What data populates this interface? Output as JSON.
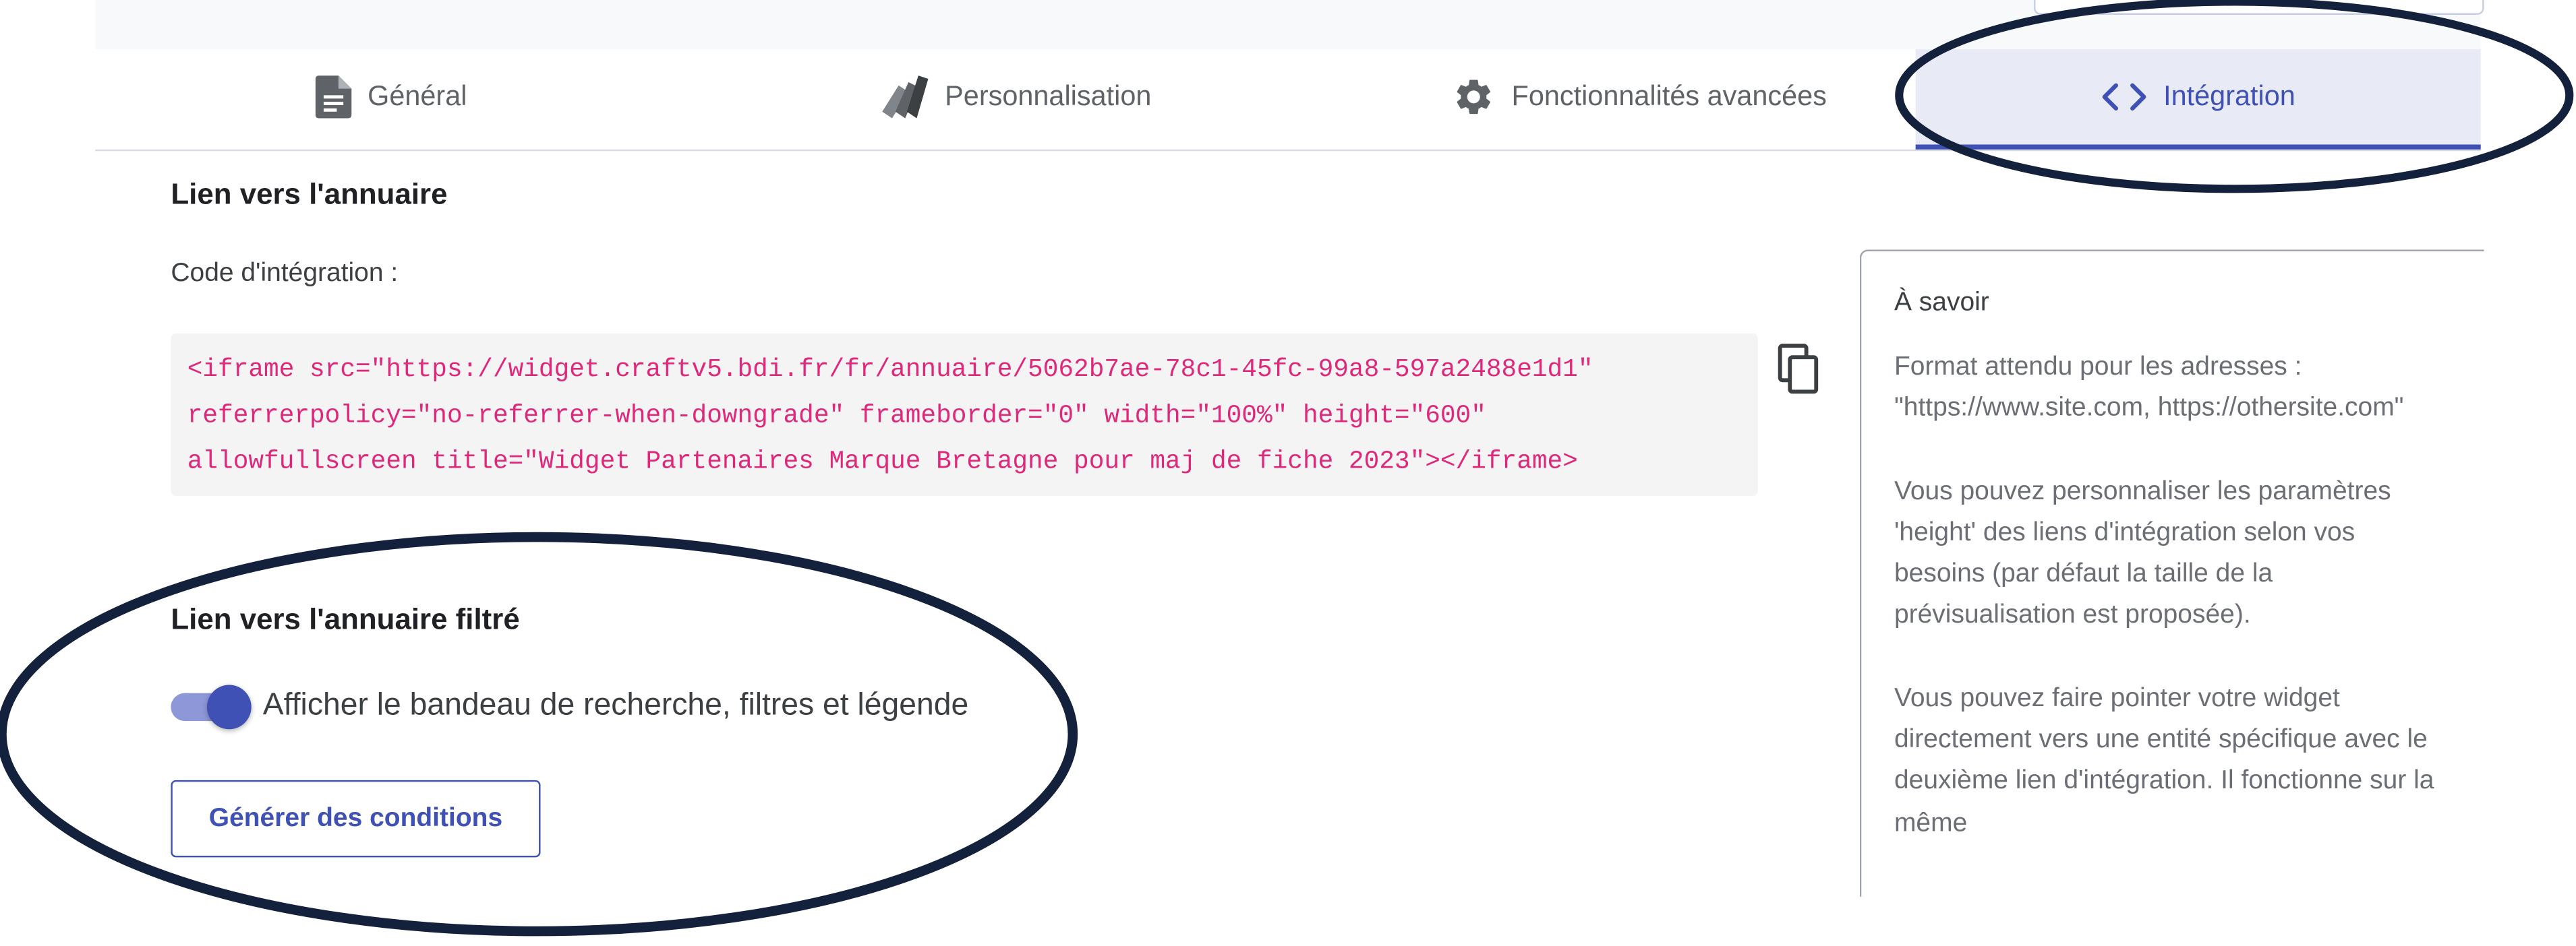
{
  "tabs": {
    "general": "Général",
    "personnalisation": "Personnalisation",
    "fonctionnalites": "Fonctionnalités avancées",
    "integration": "Intégration"
  },
  "active_tab": "integration",
  "section_lien": {
    "title": "Lien vers l'annuaire",
    "code_label": "Code d'intégration :",
    "code_lines": [
      "<iframe src=\"https://widget.craftv5.bdi.fr/fr/annuaire/5062b7ae-78c1-45fc-99a8-597a2488e1d1\"",
      "referrerpolicy=\"no-referrer-when-downgrade\" frameborder=\"0\" width=\"100%\" height=\"600\"",
      "allowfullscreen title=\"Widget Partenaires Marque Bretagne pour maj de fiche 2023\"></iframe>"
    ]
  },
  "section_filtre": {
    "title": "Lien vers l'annuaire filtré",
    "toggle_label": "Afficher le bandeau de recherche, filtres et légende",
    "toggle_on": true,
    "button_label": "Générer des conditions"
  },
  "info": {
    "title": "À savoir",
    "paragraphs": [
      "Format attendu pour les adresses : \"https://www.site.com, https://othersite.com\"",
      "Vous pouvez personnaliser les paramètres 'height' des liens d'intégration selon vos besoins (par défaut la taille de la prévisualisation est proposée).",
      "Vous pouvez faire pointer votre widget directement vers une entité spécifique avec le deuxième lien d'intégration. Il fonctionne sur la même"
    ]
  },
  "icons": {
    "general": "document-icon",
    "personnalisation": "palette-icon",
    "fonctionnalites": "gear-icon",
    "integration": "code-icon",
    "copy": "copy-icon"
  },
  "colors": {
    "accent": "#3f51b5",
    "active_tab_bg": "#e8eaf6",
    "code_text": "#e0287a",
    "annotation": "#14213d"
  }
}
